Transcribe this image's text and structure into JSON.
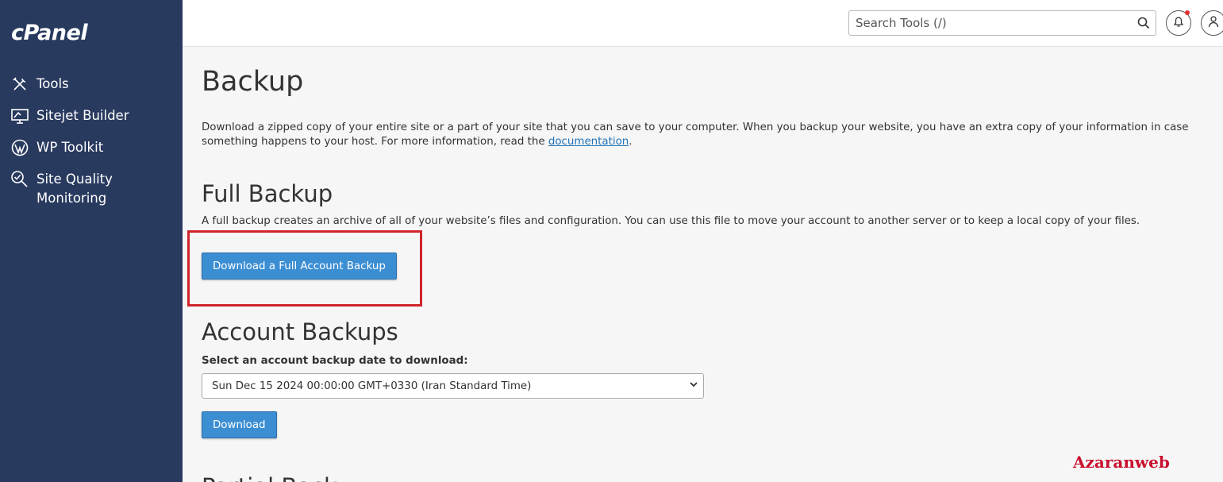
{
  "brand": {
    "logo": "cPanel"
  },
  "sidebar": {
    "items": [
      {
        "label": "Tools",
        "icon": "tools-icon"
      },
      {
        "label": "Sitejet Builder",
        "icon": "monitor-icon"
      },
      {
        "label": "WP Toolkit",
        "icon": "wordpress-icon"
      },
      {
        "label": "Site Quality",
        "label2": "Monitoring",
        "icon": "site-quality-icon"
      }
    ]
  },
  "header": {
    "search_placeholder": "Search Tools (/)",
    "notification_icon": "bell-icon",
    "user_icon": "user-icon",
    "notification_dot_color": "#e0312f"
  },
  "main": {
    "title": "Backup",
    "intro_text": "Download a zipped copy of your entire site or a part of your site that you can save to your computer. When you backup your website, you have an extra copy of your information in case something happens to your host. For more information, read the ",
    "intro_link": "documentation",
    "intro_end": ".",
    "full_backup": {
      "heading": "Full Backup",
      "description": "A full backup creates an archive of all of your website’s files and configuration. You can use this file to move your account to another server or to keep a local copy of your files.",
      "button_label": "Download a Full Account Backup"
    },
    "account_backups": {
      "heading": "Account Backups",
      "select_label": "Select an account backup date to download:",
      "selected_option": "Sun Dec 15 2024 00:00:00 GMT+0330 (Iran Standard Time)",
      "button_label": "Download"
    },
    "partial_heading_visible": "Partial Back"
  },
  "watermark": "Azaranweb",
  "colors": {
    "sidebar_bg": "#293a5f",
    "button_bg": "#3c8ed3",
    "highlight_border": "#d0242b",
    "link": "#1f73b7",
    "watermark": "#c8102e"
  }
}
